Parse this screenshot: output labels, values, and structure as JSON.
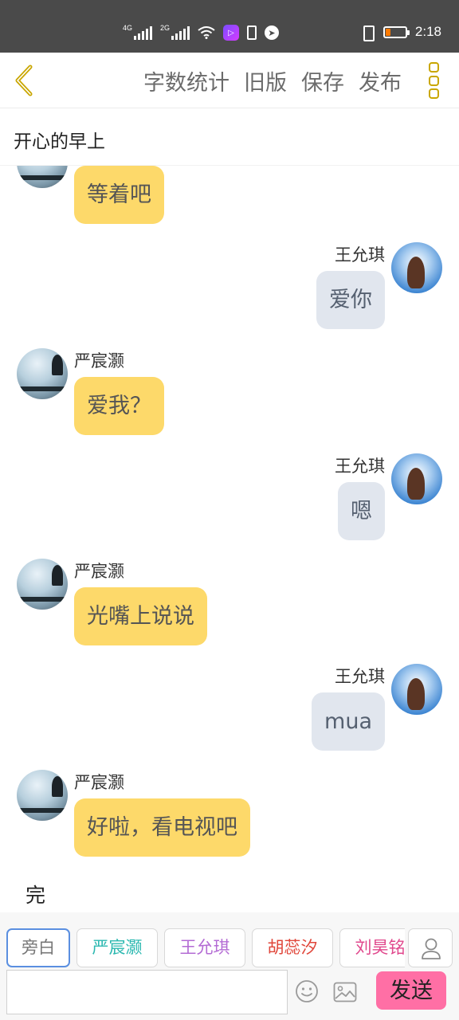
{
  "status_bar": {
    "net1": "4G",
    "net2": "2G",
    "time": "2:18",
    "battery_level": 0.22,
    "battery_color": "#ff7a00"
  },
  "toolbar": {
    "back_icon": "chevron-left-icon",
    "actions": [
      "字数统计",
      "旧版",
      "保存",
      "发布"
    ],
    "more_icon": "more-vertical-icon",
    "accent": "#c9a600"
  },
  "title": "开心的早上",
  "messages": [
    {
      "side": "left",
      "name": "",
      "text": "等着吧"
    },
    {
      "side": "right",
      "name": "王允琪",
      "text": "爱你"
    },
    {
      "side": "left",
      "name": "严宸灏",
      "text": "爱我？"
    },
    {
      "side": "right",
      "name": "王允琪",
      "text": "嗯"
    },
    {
      "side": "left",
      "name": "严宸灏",
      "text": "光嘴上说说"
    },
    {
      "side": "right",
      "name": "王允琪",
      "text": "mua"
    },
    {
      "side": "left",
      "name": "严宸灏",
      "text": "好啦，看电视吧"
    }
  ],
  "end_text": "完",
  "characters": [
    {
      "label": "旁白",
      "color": "#777777"
    },
    {
      "label": "严宸灏",
      "color": "#2bb8b0"
    },
    {
      "label": "王允琪",
      "color": "#b36bd4"
    },
    {
      "label": "胡蕊汐",
      "color": "#e0463a"
    },
    {
      "label": "刘昊铭",
      "color": "#e0478c"
    }
  ],
  "input": {
    "value": "",
    "placeholder": ""
  },
  "send_label": "发送",
  "colors": {
    "bubble_left": "#fdd96a",
    "bubble_right": "#e1e6ee",
    "send": "#ff6fa5"
  }
}
